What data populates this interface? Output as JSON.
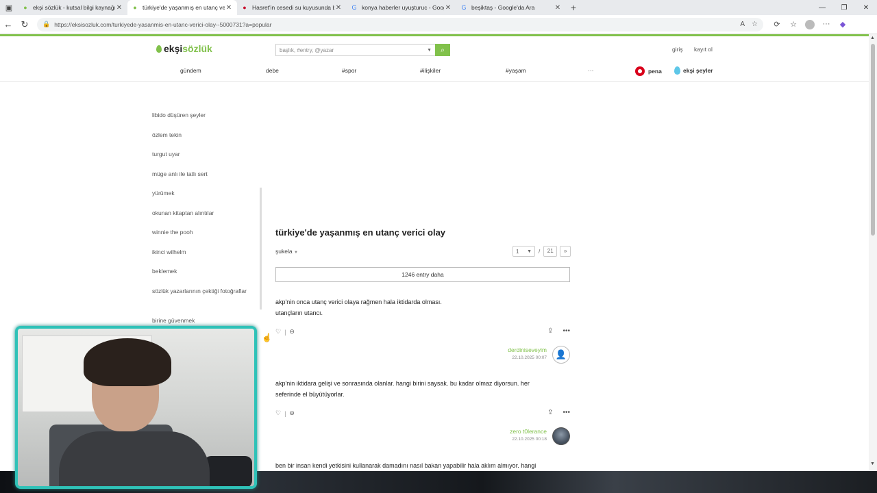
{
  "browser": {
    "tabs": [
      {
        "title": "ekşi sözlük - kutsal bilgi kaynağı",
        "icon": "eksi-icon"
      },
      {
        "title": "türkiye'de yaşanmış en utanç veric",
        "icon": "eksi-icon",
        "active": true
      },
      {
        "title": "Hasret'in cesedi su kuyusunda bu",
        "icon": "news-icon"
      },
      {
        "title": "konya haberler uyuşturuc - Googl",
        "icon": "google-icon"
      },
      {
        "title": "beşiktaş - Google'da Ara",
        "icon": "google-icon"
      }
    ],
    "url": "https://eksisozluk.com/turkiyede-yasanmis-en-utanc-verici-olay--5000731?a=popular"
  },
  "site": {
    "logo_part1": "ekşi",
    "logo_part2": "sözlük",
    "search_placeholder": "başlık, #entry, @yazar",
    "login": "giriş",
    "register": "kayıt ol",
    "nav": [
      "gündem",
      "debe",
      "#spor",
      "#ilişkiler",
      "#yaşam",
      "···"
    ],
    "brand_pena": "pena",
    "brand_eksi_seyler": "ekşi şeyler",
    "accent": "#81c14b"
  },
  "sidebar": {
    "items": [
      "libido düşüren şeyler",
      "özlem tekin",
      "turgut uyar",
      "müge anlı ile tatlı sert",
      "yürümek",
      "okunan kitaptan alıntılar",
      "winnie the pooh",
      "ikinci wilhelm",
      "beklemek",
      "sözlük yazarlarının çektiği fotoğraflar",
      "birine güvenmek"
    ]
  },
  "topic": {
    "title": "türkiye'de yaşanmış en utanç verici olay",
    "sort": "şukela",
    "page_current": "1",
    "page_total": "21",
    "page_next": "»",
    "more_entries": "1246 entry daha"
  },
  "entries": [
    {
      "lines": [
        "akp'nin onca utanç verici olaya rağmen hala iktidarda olması.",
        "utançların utancı."
      ],
      "author": "derdiniseveyim",
      "date": "22.10.2025 00:07"
    },
    {
      "lines": [
        "akp'nin iktidara gelişi ve sonrasında olanlar. hangi birini saysak. bu kadar olmaz diyorsun. her",
        "seferinde el büyütüyorlar."
      ],
      "author": "zero t0lerance",
      "date": "22.10.2025 00:18"
    },
    {
      "lines": [
        "ben bir insan kendi yetkisini kullanarak damadını nasıl bakan yapabilir hala aklım almıyor. hangi"
      ]
    }
  ]
}
